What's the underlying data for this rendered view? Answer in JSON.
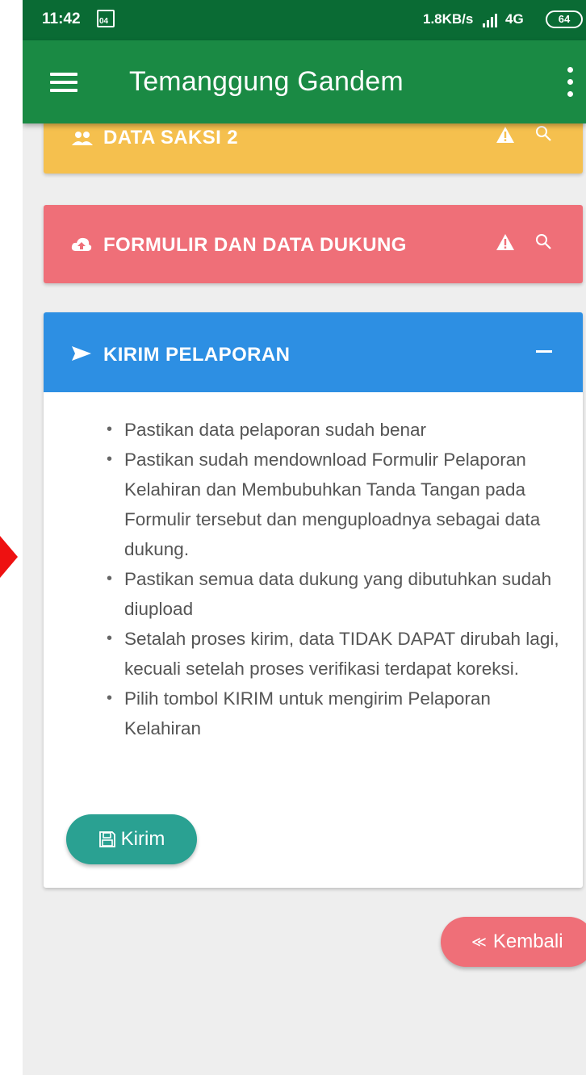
{
  "status_bar": {
    "time": "11:42",
    "image_badge": "04",
    "network_speed": "1.8KB/s",
    "network_type": "4G",
    "battery": "64"
  },
  "app_bar": {
    "title": "Temanggung Gandem"
  },
  "cards": {
    "saksi": {
      "title": "DATA SAKSI 2",
      "color": "#f5c04e"
    },
    "formulir": {
      "title": "FORMULIR DAN DATA DUKUNG",
      "color": "#ef6f78"
    },
    "kirim": {
      "title": "KIRIM PELAPORAN",
      "color": "#2d8fe3",
      "instructions": [
        "Pastikan data pelaporan sudah benar",
        "Pastikan sudah mendownload Formulir Pelaporan Kelahiran dan Membubuhkan Tanda Tangan pada Formulir tersebut dan menguploadnya sebagai data dukung.",
        "Pastikan semua data dukung yang dibutuhkan sudah diupload",
        "Setalah proses kirim, data TIDAK DAPAT dirubah lagi, kecuali setelah proses verifikasi terdapat koreksi.",
        "Pilih tombol KIRIM untuk mengirim Pelaporan Kelahiran"
      ],
      "submit_label": "Kirim"
    }
  },
  "back_button": {
    "label": "Kembali"
  },
  "icons": [
    "menu-icon",
    "overflow-icon",
    "users-icon",
    "cloud-upload-icon",
    "warning-icon",
    "search-icon",
    "send-icon",
    "collapse-icon",
    "floppy-disk-icon",
    "rewind-icon"
  ]
}
